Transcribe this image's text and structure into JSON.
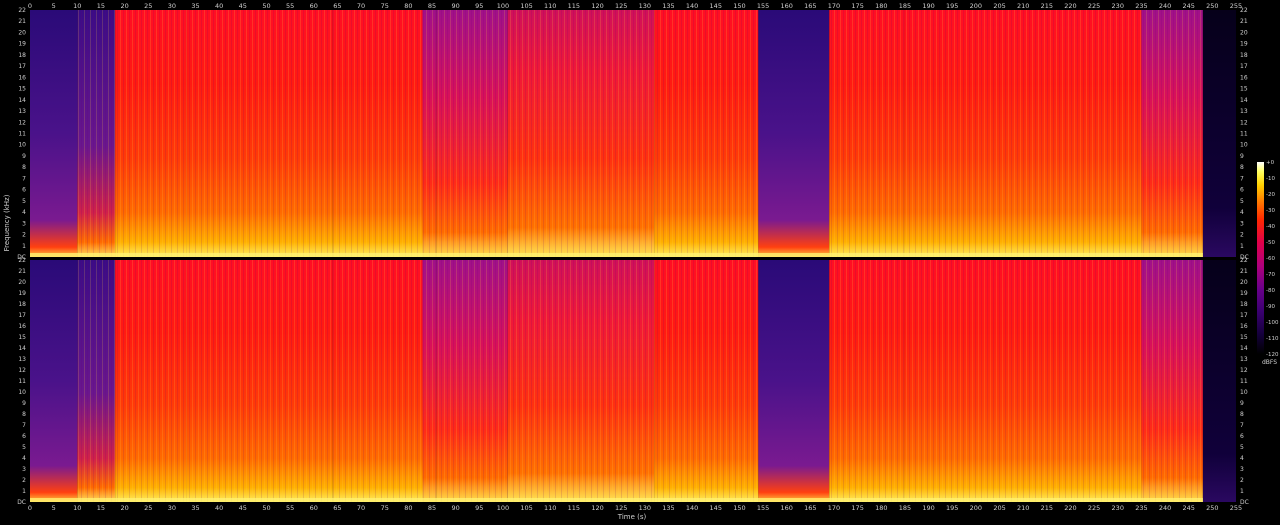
{
  "chart_data": {
    "type": "heatmap",
    "subtype": "spectrogram",
    "channels": 2,
    "xlabel": "Time (s)",
    "ylabel": "Frequency (kHz)",
    "xlim": [
      0,
      255
    ],
    "x_ticks": [
      0,
      5,
      10,
      15,
      20,
      25,
      30,
      35,
      40,
      45,
      50,
      55,
      60,
      65,
      70,
      75,
      80,
      85,
      90,
      95,
      100,
      105,
      110,
      115,
      120,
      125,
      130,
      135,
      140,
      145,
      150,
      155,
      160,
      165,
      170,
      175,
      180,
      185,
      190,
      195,
      200,
      205,
      210,
      215,
      220,
      225,
      230,
      235,
      240,
      245,
      250,
      255
    ],
    "ylim_khz": [
      0,
      22
    ],
    "y_tick_labels": [
      "DC",
      "1",
      "2",
      "3",
      "4",
      "5",
      "6",
      "7",
      "8",
      "9",
      "10",
      "11",
      "12",
      "13",
      "14",
      "15",
      "16",
      "17",
      "18",
      "19",
      "20",
      "21",
      "22"
    ],
    "colorbar": {
      "label": "dBFS",
      "range": [
        -120,
        0
      ],
      "ticks": [
        "+0",
        "-10",
        "-20",
        "-30",
        "-40",
        "-50",
        "-60",
        "-70",
        "-80",
        "-90",
        "-100",
        "-110",
        "-120"
      ],
      "colors": [
        "#ffffff",
        "#ffff60",
        "#ffd000",
        "#ff8000",
        "#ff2800",
        "#e0004a",
        "#b0007a",
        "#6a008a",
        "#3a0070",
        "#14003a",
        "#000000"
      ]
    },
    "segments": [
      {
        "start": 0,
        "end": 10,
        "level": "quiet"
      },
      {
        "start": 10,
        "end": 18,
        "level": "build-up"
      },
      {
        "start": 18,
        "end": 33,
        "level": "loud"
      },
      {
        "start": 33,
        "end": 64,
        "level": "loud"
      },
      {
        "start": 64,
        "end": 83,
        "level": "loud"
      },
      {
        "start": 83,
        "end": 86,
        "level": "medium"
      },
      {
        "start": 86,
        "end": 101,
        "level": "medium"
      },
      {
        "start": 101,
        "end": 132,
        "level": "medium-loud"
      },
      {
        "start": 132,
        "end": 154,
        "level": "loud"
      },
      {
        "start": 154,
        "end": 169,
        "level": "quiet"
      },
      {
        "start": 169,
        "end": 185,
        "level": "loud"
      },
      {
        "start": 185,
        "end": 235,
        "level": "loud"
      },
      {
        "start": 235,
        "end": 248,
        "level": "medium"
      },
      {
        "start": 248,
        "end": 255,
        "level": "silent"
      }
    ]
  }
}
